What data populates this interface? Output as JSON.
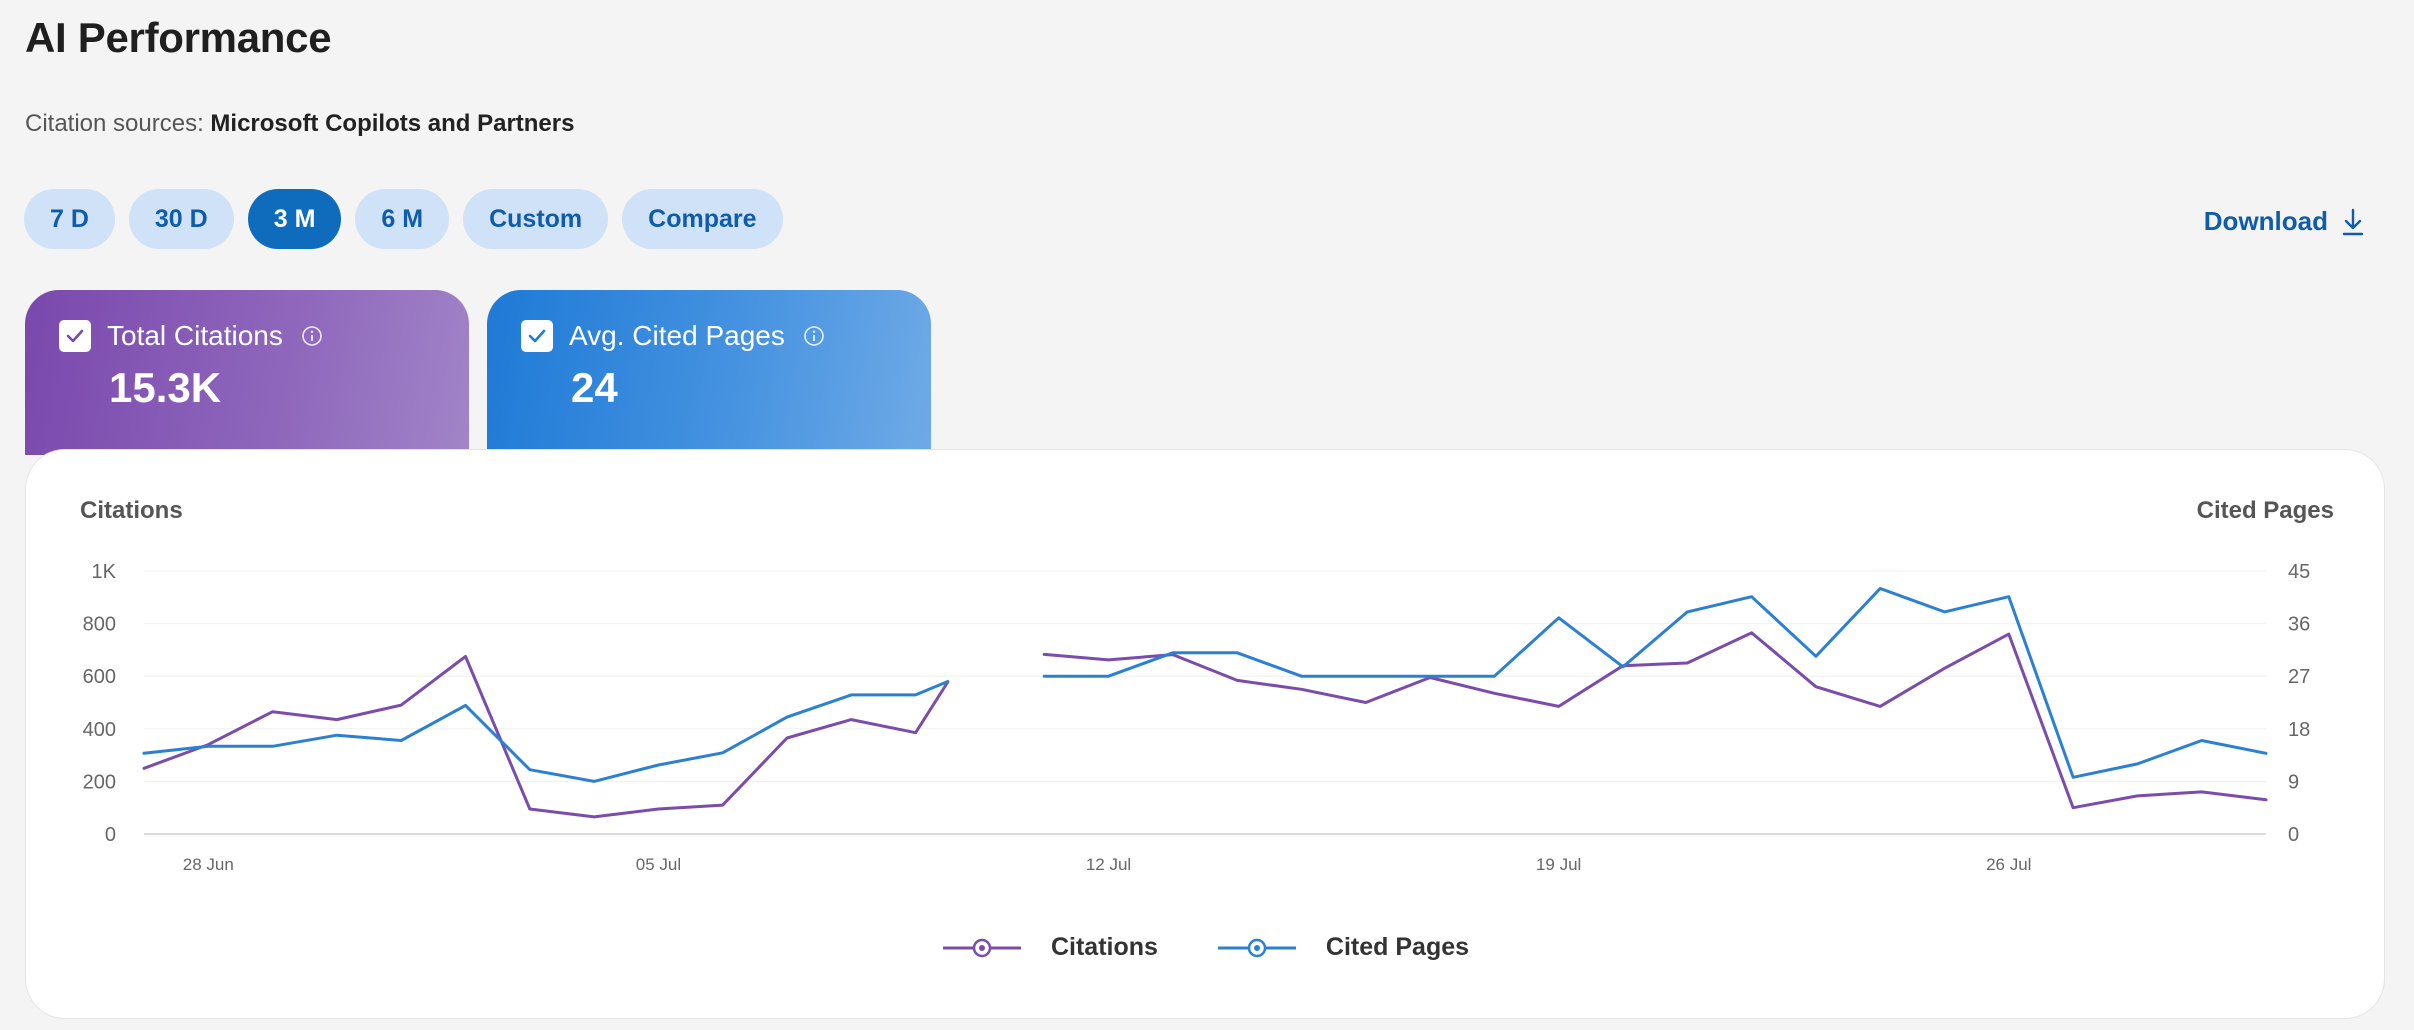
{
  "page": {
    "title": "AI Performance",
    "citation_label": "Citation sources:",
    "citation_source": "Microsoft Copilots and Partners"
  },
  "ranges": [
    {
      "label": "7 D",
      "active": false
    },
    {
      "label": "30 D",
      "active": false
    },
    {
      "label": "3 M",
      "active": true
    },
    {
      "label": "6 M",
      "active": false
    },
    {
      "label": "Custom",
      "active": false
    },
    {
      "label": "Compare",
      "active": false
    }
  ],
  "download_label": "Download",
  "metrics": [
    {
      "label": "Total Citations",
      "value": "15.3K",
      "checked": true
    },
    {
      "label": "Avg. Cited Pages",
      "value": "24",
      "checked": true
    }
  ],
  "chart_data": {
    "type": "line",
    "left_axis_title": "Citations",
    "right_axis_title": "Cited Pages",
    "y_left": {
      "min": 0,
      "max": 1000,
      "ticks": [
        0,
        200,
        400,
        600,
        800,
        1000
      ],
      "tick_labels": [
        "0",
        "200",
        "400",
        "600",
        "800",
        "1K"
      ]
    },
    "y_right": {
      "min": 0,
      "max": 45,
      "ticks": [
        0,
        9,
        18,
        27,
        36,
        45
      ],
      "tick_labels": [
        "0",
        "9",
        "18",
        "27",
        "36",
        "45"
      ]
    },
    "x_ticks": [
      {
        "label": "28 Jun",
        "day": 1
      },
      {
        "label": "05 Jul",
        "day": 8
      },
      {
        "label": "12 Jul",
        "day": 15
      },
      {
        "label": "19 Jul",
        "day": 22
      },
      {
        "label": "26 Jul",
        "day": 29
      }
    ],
    "x_range": [
      0,
      33
    ],
    "grid": true,
    "legend_position": "bottom-center",
    "series": [
      {
        "name": "Citations",
        "axis": "left",
        "color": "#7a4cab",
        "points": [
          [
            0,
            250
          ],
          [
            1,
            340
          ],
          [
            2,
            465
          ],
          [
            3,
            435
          ],
          [
            4,
            490
          ],
          [
            5,
            675
          ],
          [
            6,
            95
          ],
          [
            7,
            65
          ],
          [
            8,
            95
          ],
          [
            9,
            110
          ],
          [
            10,
            365
          ],
          [
            11,
            435
          ],
          [
            12,
            385
          ],
          [
            12.5,
            578
          ],
          null,
          [
            14,
            683
          ],
          [
            15,
            662
          ],
          [
            16,
            682
          ],
          [
            17,
            584
          ],
          [
            18,
            550
          ],
          [
            19,
            500
          ],
          [
            20,
            595
          ],
          [
            21,
            535
          ],
          [
            22,
            485
          ],
          [
            23,
            640
          ],
          [
            24,
            650
          ],
          [
            25,
            765
          ],
          [
            26,
            560
          ],
          [
            27,
            485
          ],
          [
            28,
            630
          ],
          [
            29,
            760
          ],
          [
            30,
            100
          ],
          [
            31,
            145
          ],
          [
            32,
            160
          ],
          [
            33,
            130
          ]
        ]
      },
      {
        "name": "Cited Pages",
        "axis": "right",
        "color": "#2b80d3",
        "points": [
          [
            0,
            13.8
          ],
          [
            1,
            15
          ],
          [
            2,
            15
          ],
          [
            3,
            16.9
          ],
          [
            4,
            16
          ],
          [
            5,
            22
          ],
          [
            6,
            11
          ],
          [
            7,
            9
          ],
          [
            8,
            11.8
          ],
          [
            9,
            13.9
          ],
          [
            10,
            20
          ],
          [
            11,
            23.8
          ],
          [
            12,
            23.8
          ],
          [
            12.5,
            26.1
          ],
          null,
          [
            14,
            27
          ],
          [
            15,
            27
          ],
          [
            16,
            31
          ],
          [
            17,
            31
          ],
          [
            18,
            27
          ],
          [
            19,
            27
          ],
          [
            20,
            27
          ],
          [
            21,
            27
          ],
          [
            22,
            37
          ],
          [
            23,
            28.6
          ],
          [
            24,
            38
          ],
          [
            25,
            40.6
          ],
          [
            26,
            30.4
          ],
          [
            27,
            42
          ],
          [
            28,
            38
          ],
          [
            29,
            40.6
          ],
          [
            30,
            9.7
          ],
          [
            31,
            12
          ],
          [
            32,
            16
          ],
          [
            33,
            13.8
          ]
        ]
      }
    ]
  }
}
